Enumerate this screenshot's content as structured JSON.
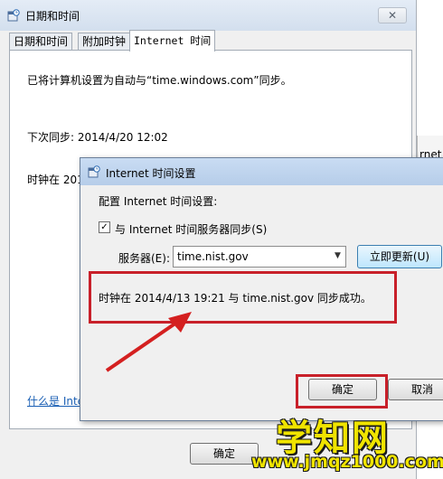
{
  "main_window": {
    "title": "日期和时间",
    "close_glyph": "✕",
    "tabs": [
      {
        "label": "日期和时间"
      },
      {
        "label": "附加时钟"
      },
      {
        "label": "Internet 时间"
      }
    ],
    "auto_sync_text": "已将计算机设置为自动与“time.windows.com”同步。",
    "next_sync_text": "下次同步: 2014/4/20 12:02",
    "clock_partial_text": "时钟在 201",
    "whatis_link_text": "什么是 Inte",
    "ok_label": "确定"
  },
  "background_window": {
    "partial_text": "rnet"
  },
  "dialog": {
    "title": "Internet 时间设置",
    "configure_label": "配置 Internet 时间设置:",
    "sync_checkbox_checked": true,
    "sync_checkbox_mark": "✓",
    "sync_label": "与 Internet 时间服务器同步(S)",
    "server_label": "服务器(E):",
    "server_value": "time.nist.gov",
    "update_button_label": "立即更新(U)",
    "success_text": "时钟在 2014/4/13 19:21 与 time.nist.gov 同步成功。",
    "ok_label": "确定",
    "cancel_label": "取消"
  },
  "watermark": {
    "title": "学知网",
    "url": "www.jmqz1000.com"
  },
  "colors": {
    "highlight_red": "#c8202a",
    "link_blue": "#1a5fb4",
    "watermark_yellow": "#f0e400"
  }
}
